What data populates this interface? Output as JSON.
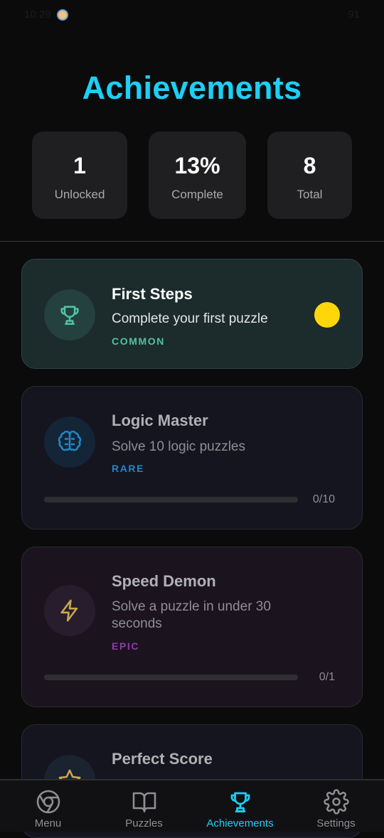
{
  "status_bar": {
    "time": "10:29",
    "battery": "91"
  },
  "header": {
    "title": "Achievements"
  },
  "stats": [
    {
      "value": "1",
      "label": "Unlocked"
    },
    {
      "value": "13%",
      "label": "Complete"
    },
    {
      "value": "8",
      "label": "Total"
    }
  ],
  "achievements": [
    {
      "title": "First Steps",
      "description": "Complete your first puzzle",
      "rarity": "COMMON",
      "icon": "trophy-icon",
      "unlocked": true,
      "color": "#4fc3a1",
      "badge_color": "#ffd60a"
    },
    {
      "title": "Logic Master",
      "description": "Solve 10 logic puzzles",
      "rarity": "RARE",
      "icon": "brain-icon",
      "unlocked": false,
      "color": "#1e88c8",
      "progress_text": "0/10",
      "progress": 0
    },
    {
      "title": "Speed Demon",
      "description": "Solve a puzzle in under 30 seconds",
      "rarity": "EPIC",
      "icon": "lightning-icon",
      "unlocked": false,
      "color": "#8a3ca8",
      "progress_text": "0/1",
      "progress": 0
    },
    {
      "title": "Perfect Score",
      "icon": "star-icon",
      "unlocked": false
    }
  ],
  "tabs": [
    {
      "label": "Menu",
      "icon": "menu-icon",
      "active": false
    },
    {
      "label": "Puzzles",
      "icon": "book-icon",
      "active": false
    },
    {
      "label": "Achievements",
      "icon": "trophy-icon",
      "active": true
    },
    {
      "label": "Settings",
      "icon": "gear-icon",
      "active": false
    }
  ],
  "colors": {
    "accent": "#1ecff5",
    "background": "#0b0b0c",
    "card": "#1f1f21"
  }
}
